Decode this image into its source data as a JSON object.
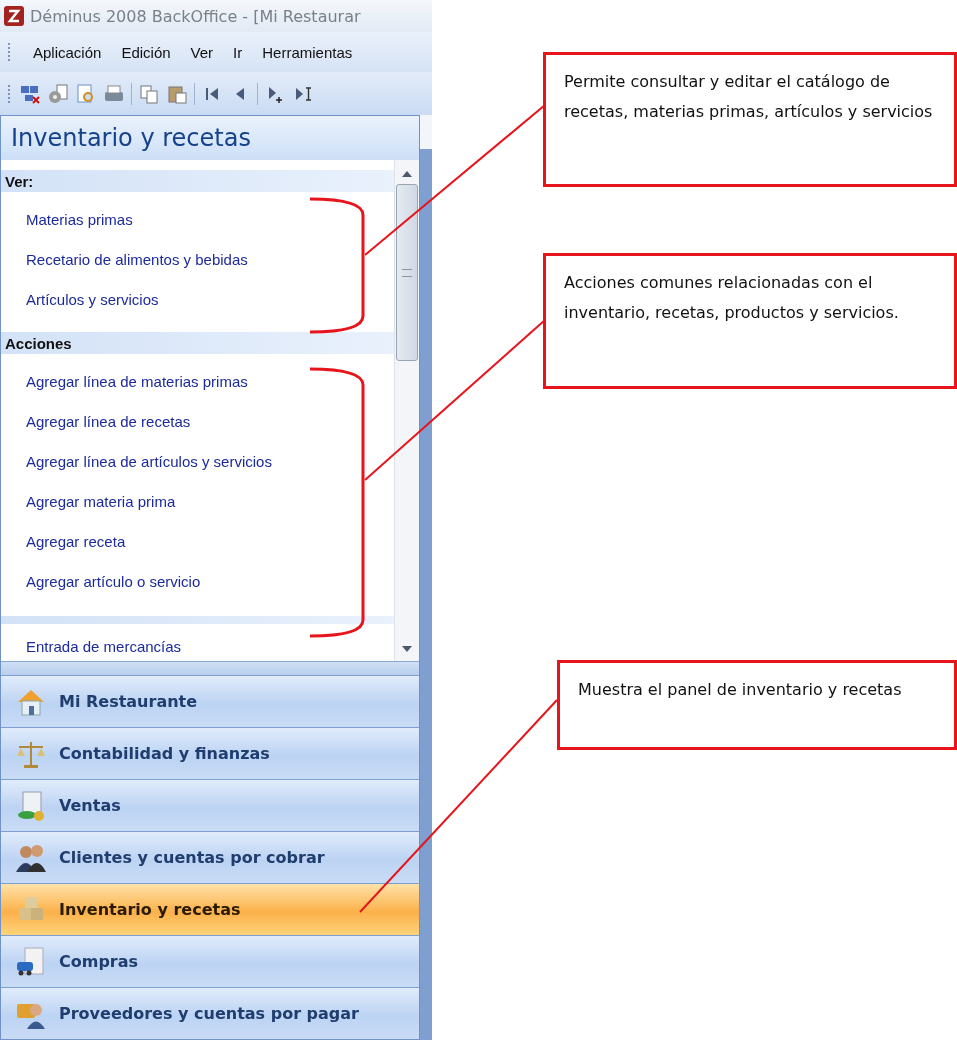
{
  "window": {
    "title": "Déminus 2008 BackOffice - [Mi Restaurar"
  },
  "menu": [
    {
      "label": "Aplicación"
    },
    {
      "label": "Edición"
    },
    {
      "label": "Ver"
    },
    {
      "label": "Ir"
    },
    {
      "label": "Herramientas"
    }
  ],
  "panel": {
    "title": "Inventario y recetas",
    "sections": [
      {
        "heading": "Ver:",
        "items": [
          "Materias primas",
          "Recetario de alimentos y bebidas",
          "Artículos y servicios"
        ]
      },
      {
        "heading": "Acciones",
        "items": [
          "Agregar línea de materias primas",
          "Agregar línea de recetas",
          "Agregar línea de artículos y servicios",
          "Agregar materia prima",
          "Agregar receta",
          "Agregar artículo o servicio"
        ]
      }
    ],
    "more_items": [
      "Entrada de mercancías"
    ]
  },
  "nav": [
    {
      "label": "Mi Restaurante",
      "selected": false
    },
    {
      "label": "Contabilidad y finanzas",
      "selected": false
    },
    {
      "label": "Ventas",
      "selected": false
    },
    {
      "label": "Clientes y cuentas por cobrar",
      "selected": false
    },
    {
      "label": "Inventario y recetas",
      "selected": true
    },
    {
      "label": "Compras",
      "selected": false
    },
    {
      "label": "Proveedores y cuentas por pagar",
      "selected": false
    }
  ],
  "callouts": [
    {
      "text": "Permite consultar y editar el catálogo de recetas, materias primas, artículos y servicios"
    },
    {
      "text": "Acciones  comunes relacionadas con el inventario, recetas, productos y servicios."
    },
    {
      "text": "Muestra el panel de inventario y recetas"
    }
  ]
}
